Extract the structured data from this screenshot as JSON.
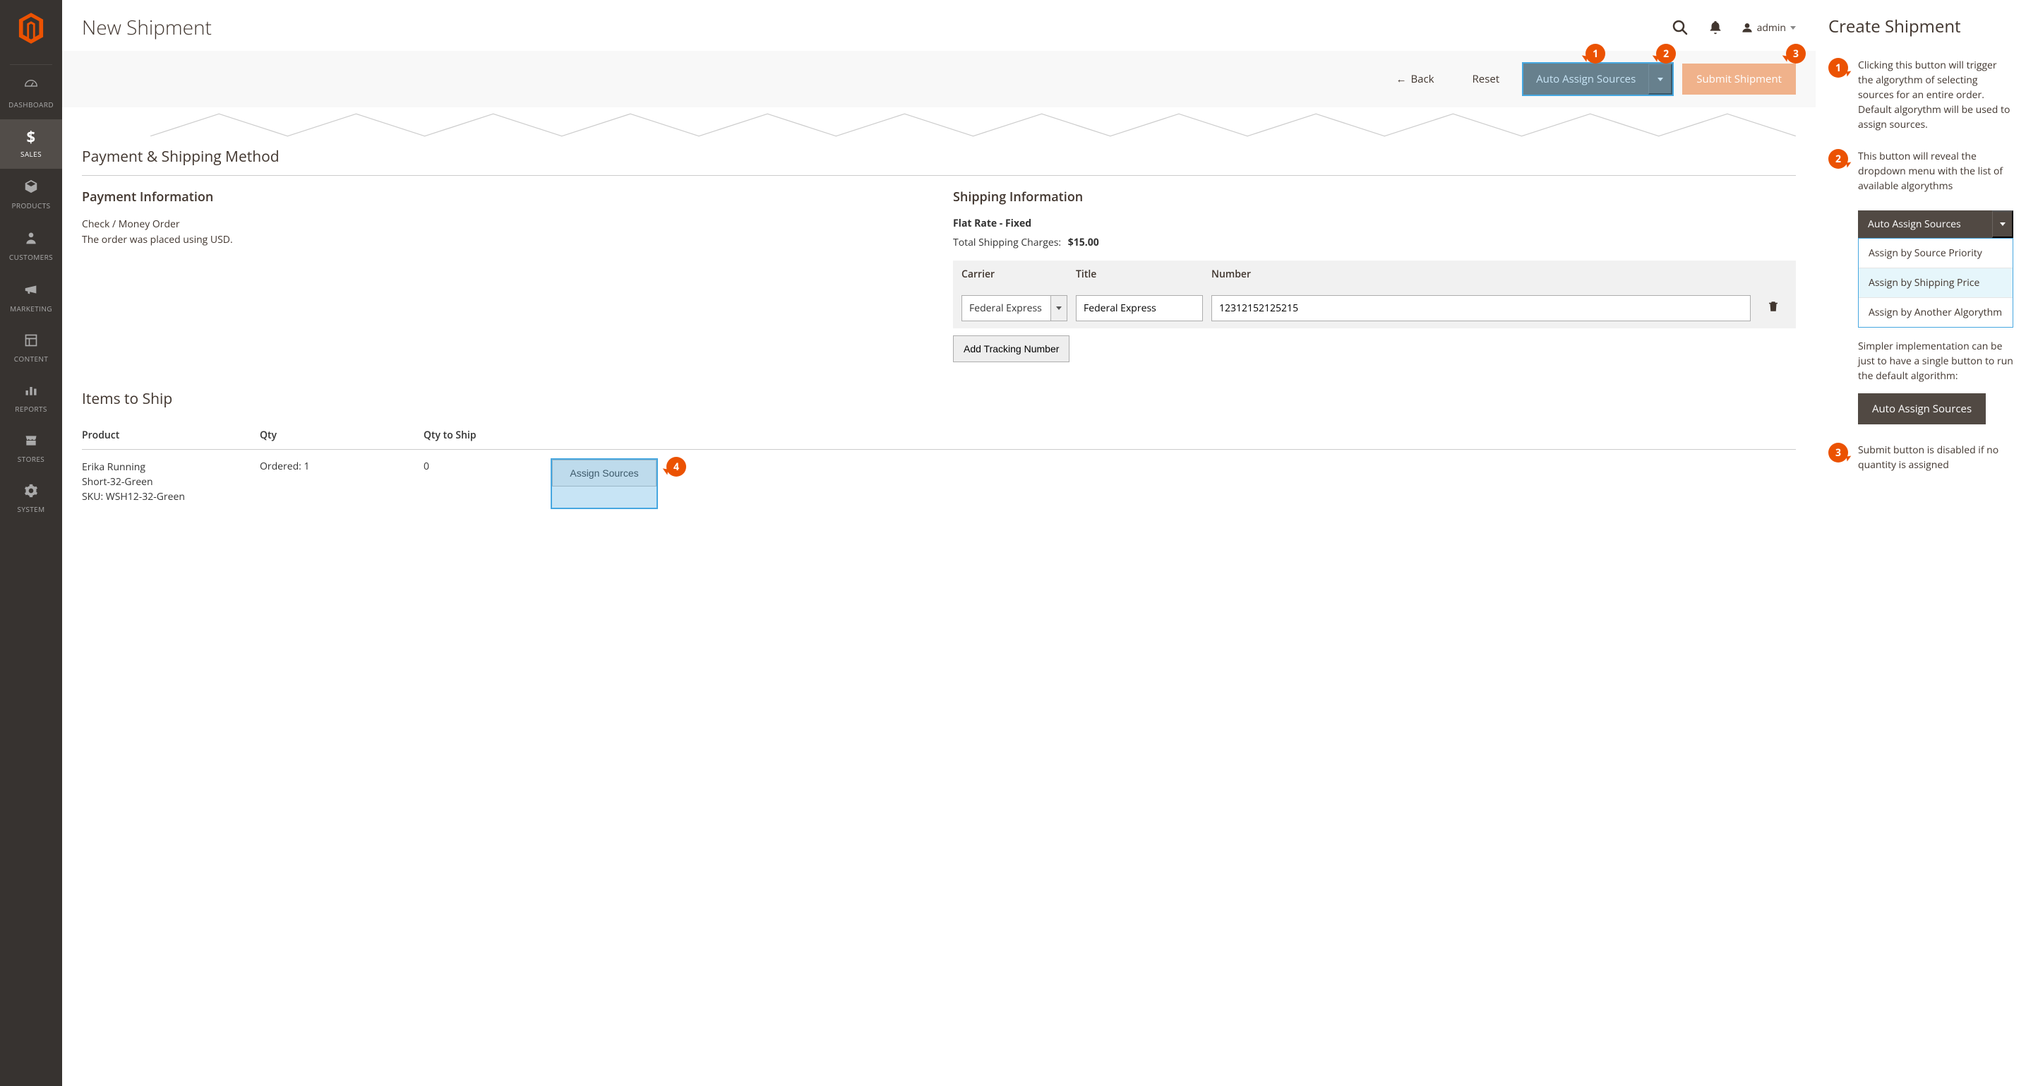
{
  "sidebar": {
    "items": [
      {
        "label": "DASHBOARD",
        "icon": "dashboard"
      },
      {
        "label": "SALES",
        "icon": "dollar",
        "active": true
      },
      {
        "label": "PRODUCTS",
        "icon": "box"
      },
      {
        "label": "CUSTOMERS",
        "icon": "person"
      },
      {
        "label": "MARKETING",
        "icon": "megaphone"
      },
      {
        "label": "CONTENT",
        "icon": "layout"
      },
      {
        "label": "REPORTS",
        "icon": "bars"
      },
      {
        "label": "STORES",
        "icon": "store"
      },
      {
        "label": "SYSTEM",
        "icon": "gear"
      }
    ]
  },
  "header": {
    "title": "New Shipment",
    "admin_user": "admin"
  },
  "toolbar": {
    "back_label": "Back",
    "reset_label": "Reset",
    "auto_assign_label": "Auto Assign Sources",
    "submit_label": "Submit Shipment",
    "submit_disabled": true
  },
  "sections": {
    "payment_shipping_title": "Payment & Shipping Method",
    "payment_info": {
      "title": "Payment Information",
      "method": "Check / Money Order",
      "currency_note": "The order was placed using USD."
    },
    "shipping_info": {
      "title": "Shipping Information",
      "rate_line": "Flat Rate - Fixed",
      "charges_label": "Total Shipping Charges:",
      "charges_value": "$15.00",
      "table": {
        "headers": {
          "carrier": "Carrier",
          "title": "Title",
          "number": "Number"
        },
        "row": {
          "carrier_selected": "Federal Express",
          "title_value": "Federal Express",
          "number_value": "12312152125215"
        },
        "add_label": "Add Tracking Number"
      }
    },
    "items": {
      "section_title": "Items to Ship",
      "headers": {
        "product": "Product",
        "qty": "Qty",
        "qty_ship": "Qty to Ship"
      },
      "row": {
        "name_line1": "Erika Running",
        "name_line2": "Short-32-Green",
        "sku_line": "SKU: WSH12-32-Green",
        "qty_text": "Ordered: 1",
        "qty_ship": "0",
        "assign_label": "Assign Sources"
      }
    }
  },
  "anno": {
    "title": "Create Shipment",
    "n1": "Clicking this button will trigger the algorythm of selecting sources for an entire order. Default algorythm will be used to assign sources.",
    "n2": "This button will reveal the dropdown menu with the list of available algorythms",
    "dropdown_label": "Auto Assign Sources",
    "menu": [
      "Assign by Source Priority",
      "Assign by Shipping Price",
      "Assign by Another Algorythm"
    ],
    "simpler": "Simpler implementation can be just to have a single button to run the default algorithm:",
    "single_button_label": "Auto Assign Sources",
    "n3": "Submit button is disabled if no quantity is assigned"
  },
  "colors": {
    "brand_orange": "#eb5202",
    "dark_btn": "#514943",
    "highlight_blue": "#46a7e0"
  }
}
